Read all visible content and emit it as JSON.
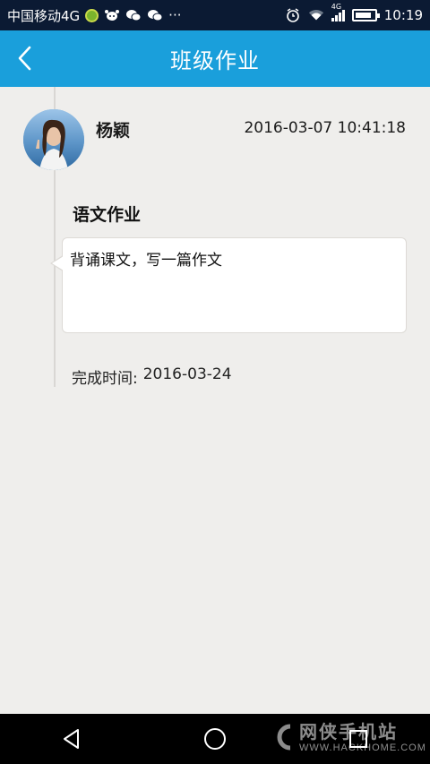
{
  "status_bar": {
    "carrier": "中国移动4G",
    "more": "···",
    "network_type": "4G",
    "time": "10:19",
    "battery_level": 0.85
  },
  "header": {
    "title": "班级作业",
    "back_icon": "chevron-left-icon"
  },
  "post": {
    "author": "杨颖",
    "timestamp": "2016-03-07 10:41:18",
    "subject": "语文作业",
    "content": "背诵课文，写一篇作文",
    "due_label": "完成时间:",
    "due_date": "2016-03-24"
  },
  "nav": {
    "back": "triangle-back-icon",
    "home": "circle-home-icon",
    "recent": "square-recent-icon"
  },
  "watermark": {
    "name": "网侠手机站",
    "url": "WWW.HACKHOME.COM"
  },
  "colors": {
    "header": "#1a9fdb",
    "status_bar": "#0b1a33",
    "background": "#efeeec"
  }
}
